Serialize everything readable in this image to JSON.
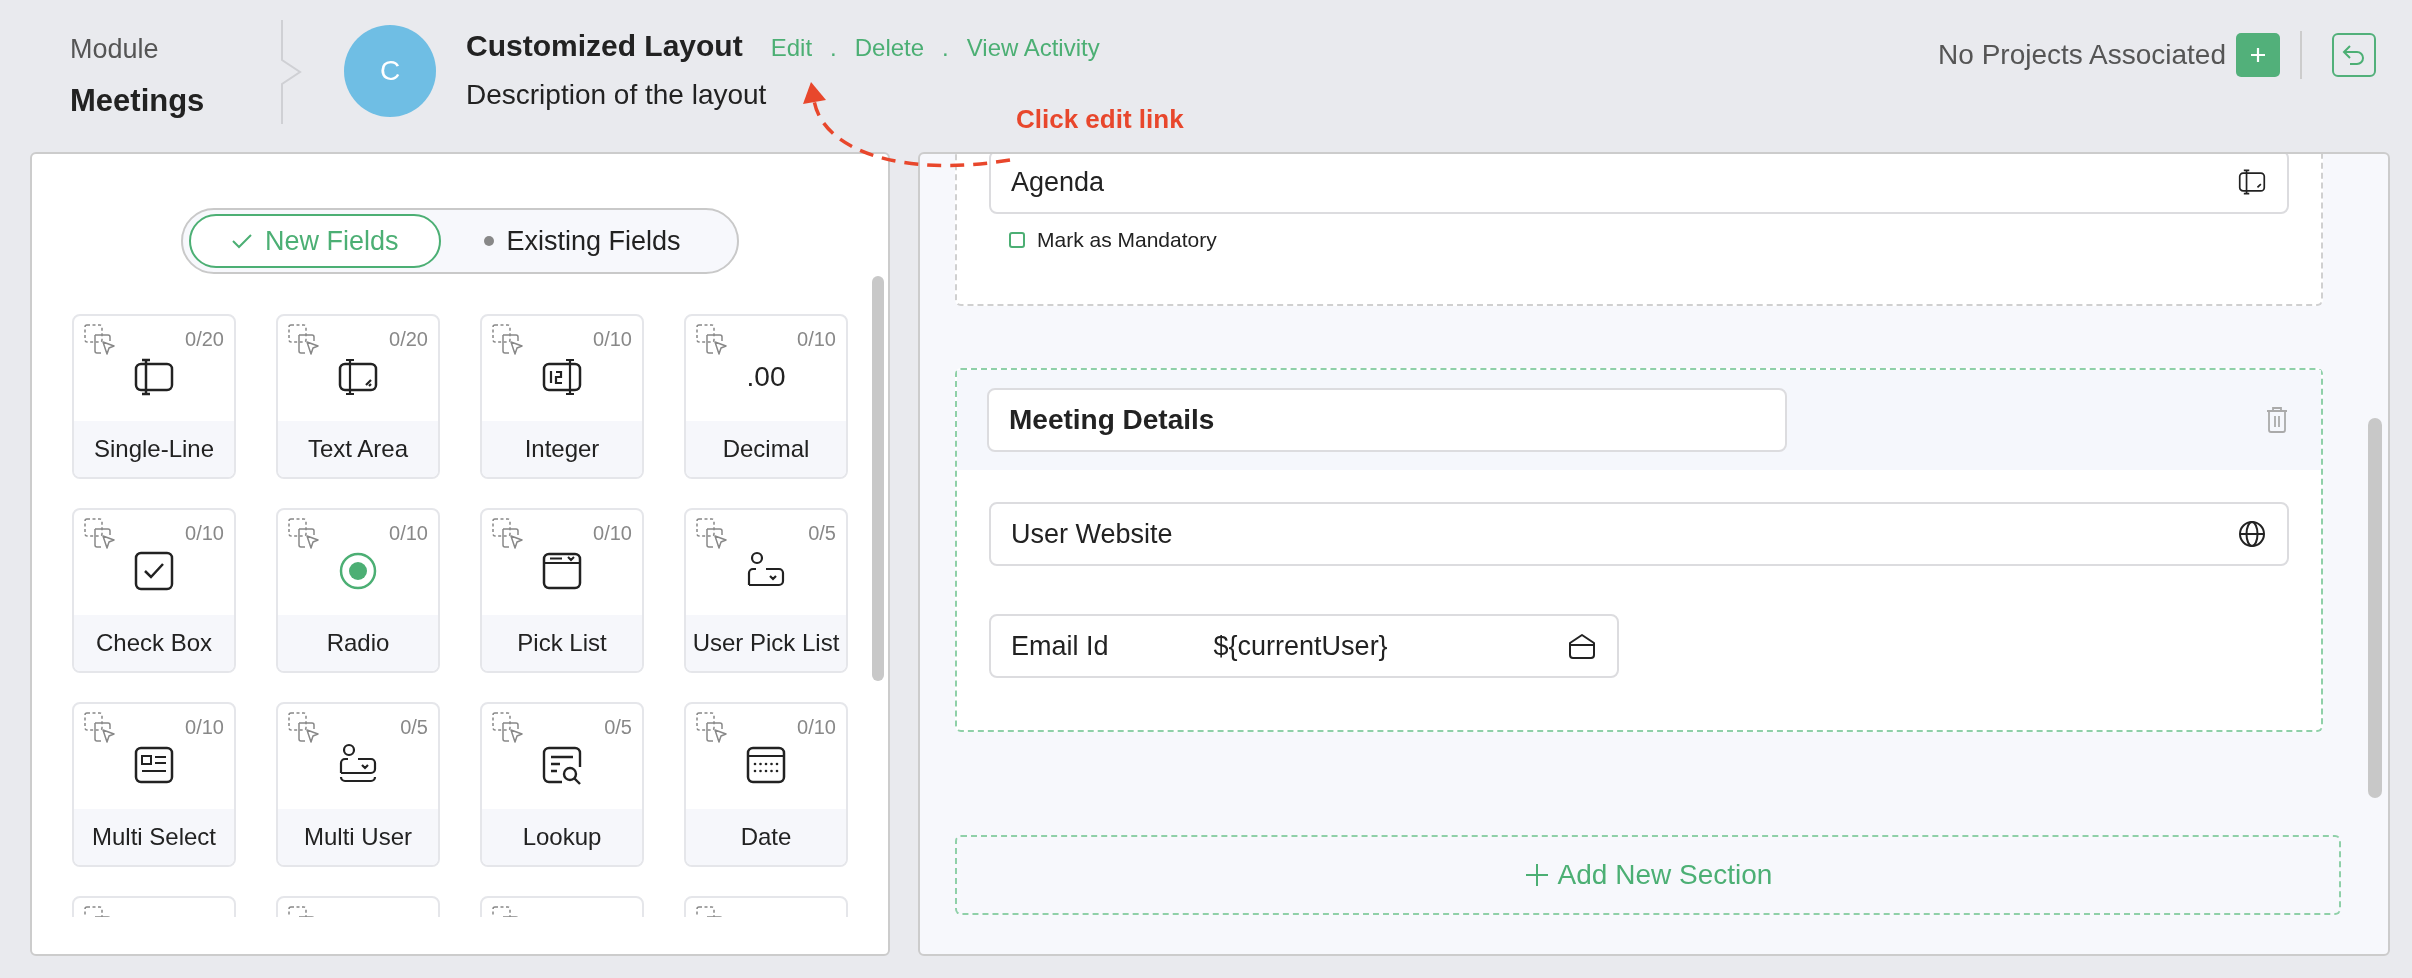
{
  "header": {
    "breadcrumb": {
      "label": "Module",
      "value": "Meetings"
    },
    "avatar_letter": "C",
    "title": "Customized Layout",
    "links": [
      {
        "label": "Edit",
        "separator_after": "."
      },
      {
        "label": "Delete",
        "separator_after": "."
      },
      {
        "label": "View Activity"
      }
    ],
    "description": "Description of the layout",
    "projects_text": "No Projects Associated"
  },
  "annotation": {
    "text": "Click edit link"
  },
  "field_tabs": [
    {
      "label": "New Fields",
      "selected": true
    },
    {
      "label": "Existing Fields",
      "selected": false
    }
  ],
  "field_types": [
    {
      "kind": "single-line",
      "label": "Single-Line",
      "count": "0/20"
    },
    {
      "kind": "text-area",
      "label": "Text Area",
      "count": "0/20"
    },
    {
      "kind": "integer",
      "label": "Integer",
      "count": "0/10"
    },
    {
      "kind": "decimal",
      "label": "Decimal",
      "count": "0/10",
      "icon_text": ".00"
    },
    {
      "kind": "check-box",
      "label": "Check Box",
      "count": "0/10"
    },
    {
      "kind": "radio",
      "label": "Radio",
      "count": "0/10"
    },
    {
      "kind": "pick-list",
      "label": "Pick List",
      "count": "0/10"
    },
    {
      "kind": "user-pick-list",
      "label": "User Pick List",
      "count": "0/5"
    },
    {
      "kind": "multi-select",
      "label": "Multi Select",
      "count": "0/10"
    },
    {
      "kind": "multi-user",
      "label": "Multi User",
      "count": "0/5"
    },
    {
      "kind": "lookup",
      "label": "Lookup",
      "count": "0/5"
    },
    {
      "kind": "date",
      "label": "Date",
      "count": "0/10"
    },
    {
      "kind": "clipped"
    },
    {
      "kind": "clipped"
    },
    {
      "kind": "clipped"
    },
    {
      "kind": "clipped"
    }
  ],
  "sections": [
    {
      "kind": "partial",
      "fields": [
        {
          "kind": "text-area",
          "label": "Agenda",
          "full_width": true
        }
      ],
      "mandatory": {
        "label": "Mark as Mandatory",
        "checked": false
      }
    },
    {
      "kind": "full",
      "title": "Meeting Details",
      "fields": [
        {
          "kind": "url",
          "label": "User Website",
          "full_width": true
        },
        {
          "kind": "email",
          "label": "Email Id",
          "value": "${currentUser}",
          "full_width": false
        }
      ]
    }
  ],
  "add_section": {
    "label": "Add New Section"
  }
}
